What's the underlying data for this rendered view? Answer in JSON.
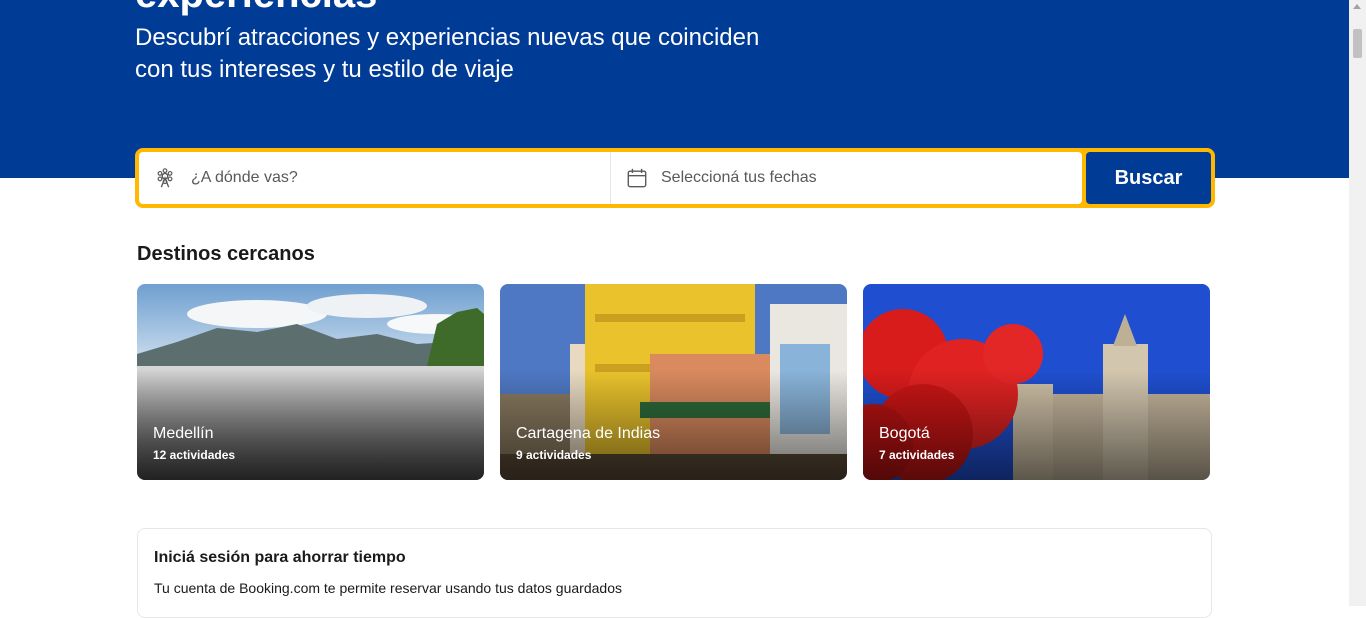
{
  "hero": {
    "title": "experiencias",
    "subtitle_line1": "Descubrí atracciones y experiencias nuevas que coinciden",
    "subtitle_line2": "con tus intereses y tu estilo de viaje"
  },
  "search": {
    "destination_placeholder": "¿A dónde vas?",
    "destination_icon": "attraction-icon",
    "dates_label": "Seleccioná tus fechas",
    "dates_icon": "calendar-icon",
    "button_label": "Buscar"
  },
  "nearby": {
    "title": "Destinos cercanos",
    "cards": [
      {
        "name": "Medellín",
        "count": "12 actividades"
      },
      {
        "name": "Cartagena de Indias",
        "count": "9 actividades"
      },
      {
        "name": "Bogotá",
        "count": "7 actividades"
      }
    ]
  },
  "login": {
    "title": "Iniciá sesión para ahorrar tiempo",
    "text": "Tu cuenta de Booking.com te permite reservar usando tus datos guardados"
  },
  "colors": {
    "brand_blue": "#003b95",
    "search_border": "#ffb700"
  }
}
